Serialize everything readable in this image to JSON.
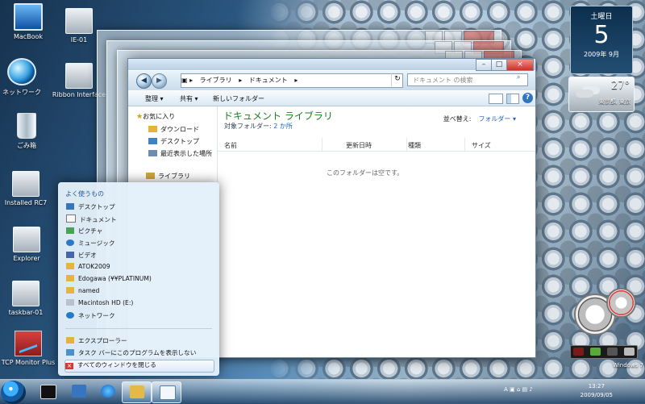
{
  "desktop": {
    "icons": [
      {
        "label": "MacBook",
        "icon": "monitor-icon"
      },
      {
        "label": "ネットワーク",
        "icon": "network-globe-icon"
      },
      {
        "label": "ごみ箱",
        "icon": "recycle-bin-icon"
      },
      {
        "label": "Installed RC7",
        "icon": "computer-icon"
      },
      {
        "label": "Explorer",
        "icon": "explorer-window-icon"
      },
      {
        "label": "taskbar-01",
        "icon": "taskbar-image-icon"
      },
      {
        "label": "TCP Monitor Plus",
        "icon": "tcp-monitor-icon"
      },
      {
        "label": "IE-01",
        "icon": "printer-device-icon"
      },
      {
        "label": "Ribbon Interface",
        "icon": "ribbon-device-icon"
      }
    ]
  },
  "explorer": {
    "address": {
      "root_icon": "computer-icon",
      "parts": [
        "ライブラリ",
        "ドキュメント"
      ]
    },
    "search_placeholder": "ドキュメント の検索",
    "toolbar": {
      "organize": "整理 ▾",
      "share": "共有 ▾",
      "new_folder": "新しいフォルダー"
    },
    "navigation": [
      {
        "label": "お気に入り",
        "icon": "star-icon"
      },
      {
        "label": "ダウンロード",
        "icon": "download-icon"
      },
      {
        "label": "デスクトップ",
        "icon": "desktop-icon"
      },
      {
        "label": "最近表示した場所",
        "icon": "recent-places-icon"
      },
      {
        "label": "ライブラリ",
        "icon": "library-icon"
      }
    ],
    "library_title": "ドキュメント ライブラリ",
    "target_label": "対象フォルダー:",
    "target_count": "2 か所",
    "arrange_label": "並べ替え:",
    "arrange_value": "フォルダー ▾",
    "columns": [
      "名前",
      "更新日時",
      "種類",
      "サイズ"
    ],
    "empty_text": "このフォルダーは空です。"
  },
  "jump_list": {
    "title": "よく使うもの",
    "items": [
      {
        "label": "デスクトップ",
        "icon": "desktop-icon"
      },
      {
        "label": "ドキュメント",
        "icon": "document-icon"
      },
      {
        "label": "ピクチャ",
        "icon": "pictures-icon"
      },
      {
        "label": "ミュージック",
        "icon": "music-icon"
      },
      {
        "label": "ビデオ",
        "icon": "video-icon"
      },
      {
        "label": "ATOK2009",
        "icon": "folder-icon"
      },
      {
        "label": "Edogawa (¥¥PLATINUM)",
        "icon": "network-folder-icon"
      },
      {
        "label": "named",
        "icon": "folder-icon"
      },
      {
        "label": "Macintosh HD (E:)",
        "icon": "drive-icon"
      },
      {
        "label": "ネットワーク",
        "icon": "network-icon"
      }
    ],
    "tasks": [
      {
        "label": "エクスプローラー",
        "icon": "explorer-icon"
      },
      {
        "label": "タスク バーにこのプログラムを表示しない",
        "icon": "pin-icon"
      },
      {
        "label": "すべてのウィンドウを閉じる",
        "icon": "close-windows-icon"
      }
    ]
  },
  "gadgets": {
    "calendar_day": "土曜日",
    "calendar_date": "5",
    "calendar_month": "2009年 9月",
    "temperature": "27°",
    "city": "東京都, 東京"
  },
  "taskbar": {
    "clock_time": "13:27",
    "clock_date": "2009/09/05",
    "tray_text": "A"
  },
  "watermark": "Windows 7"
}
